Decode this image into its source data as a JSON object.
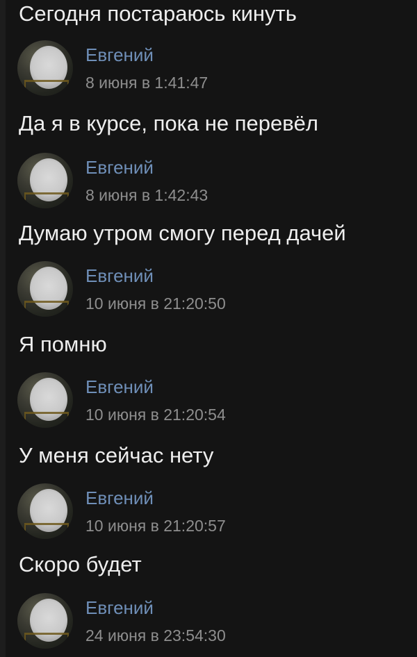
{
  "messages": [
    {
      "text": "Сегодня постараюсь кинуть",
      "author": "Евгений",
      "time": "8 июня в 1:41:47"
    },
    {
      "text": "Да я в курсе, пока не перевёл",
      "author": "Евгений",
      "time": "8 июня в 1:42:43"
    },
    {
      "text": "Думаю утром смогу перед дачей",
      "author": "Евгений",
      "time": "10 июня в 21:20:50"
    },
    {
      "text": "Я помню",
      "author": "Евгений",
      "time": "10 июня в 21:20:54"
    },
    {
      "text": "У меня сейчас нету",
      "author": "Евгений",
      "time": "10 июня в 21:20:57"
    },
    {
      "text": "Скоро будет",
      "author": "Евгений",
      "time": "24 июня в 23:54:30"
    }
  ]
}
